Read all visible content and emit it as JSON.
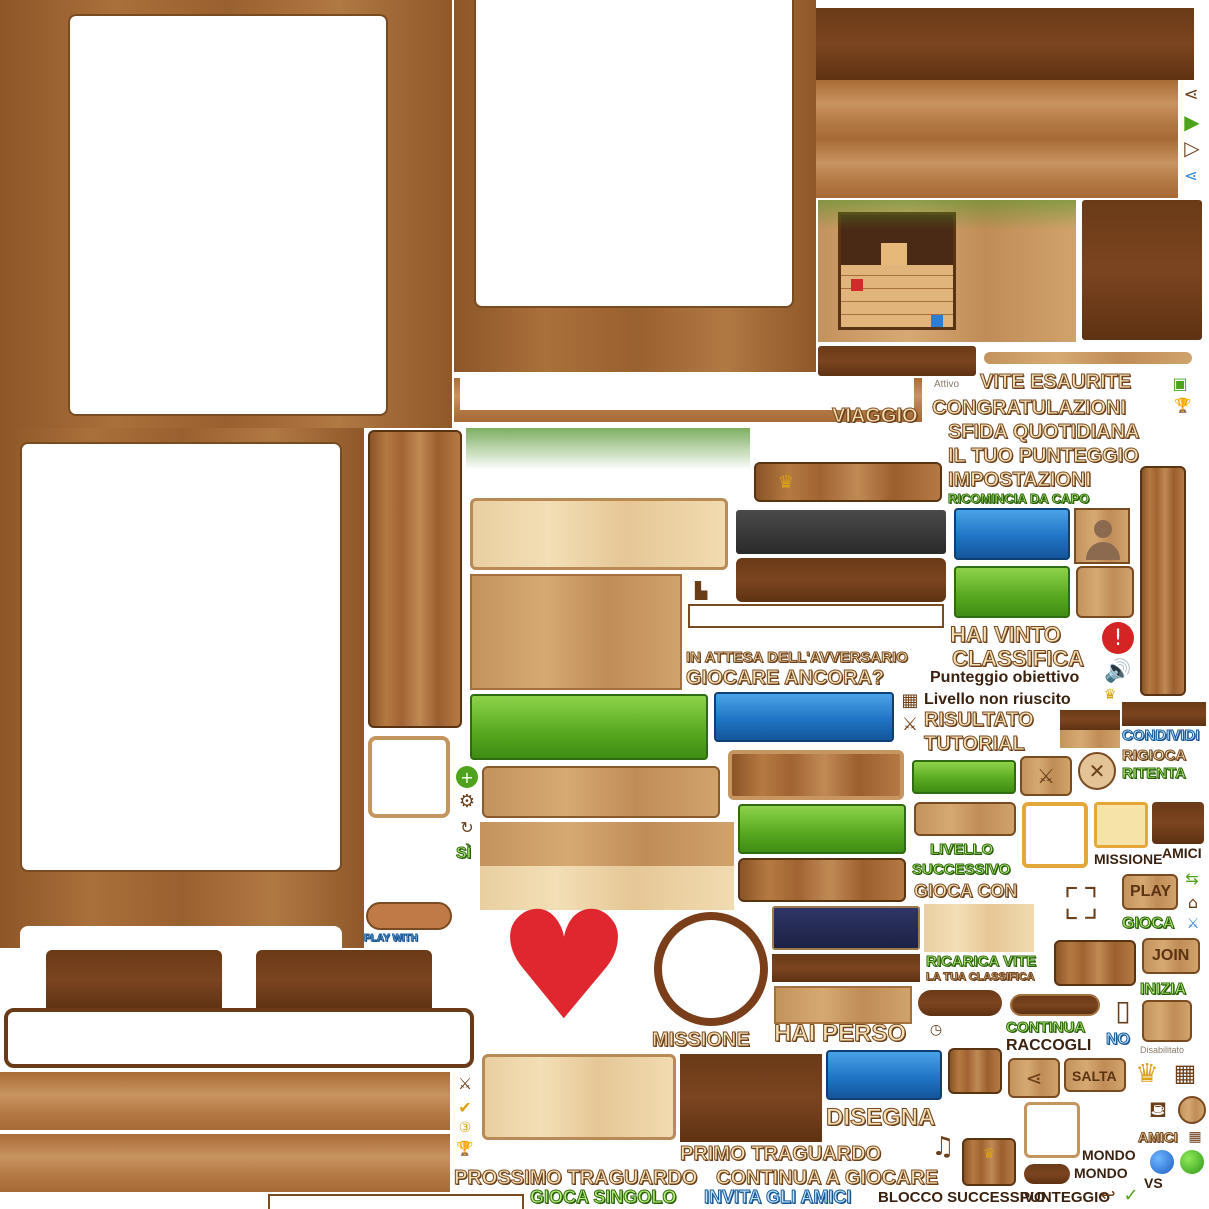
{
  "atlas": {
    "labels": {
      "attivo": "Attivo",
      "vite_esaurite": "VITE ESAURITE",
      "viaggio": "VIAGGIO",
      "congratulazioni": "CONGRATULAZIONI",
      "sfida_quotidiana": "SFIDA QUOTIDIANA",
      "il_tuo_punteggio": "IL TUO PUNTEGGIO",
      "impostazioni": "IMPOSTAZIONI",
      "ricomincia": "RICOMINCIA DA CAPO",
      "hai_vinto": "HAI VINTO",
      "classifica": "CLASSIFICA",
      "in_attesa": "IN ATTESA DELL'AVVERSARIO",
      "punteggio_obiettivo": "Punteggio obiettivo",
      "giocare_ancora": "GIOCARE ANCORA?",
      "livello_non_riuscito": "Livello non riuscito",
      "risultato": "RISULTATO",
      "tutorial": "TUTORIAL",
      "condividi": "CONDIVIDI",
      "rigioca": "RIGIOCA",
      "ritenta": "RITENTA",
      "si": "SÌ",
      "missione_small": "MISSIONE",
      "amici_small": "AMICI",
      "livello_successivo_1": "LIVELLO",
      "livello_successivo_2": "SUCCESSIVO",
      "gioca_con": "GIOCA CON",
      "play_with": "PLAY WITH",
      "play": "PLAY",
      "gioca": "GIOCA",
      "join": "JOIN",
      "ricarica_vite": "RICARICA VITE",
      "la_tua_classifica": "LA TUA CLASSIFICA",
      "inizia": "INIZIA",
      "missione": "MISSIONE",
      "hai_perso": "HAI PERSO",
      "continua": "CONTINUA",
      "raccogli": "RACCOGLI",
      "no": "NO",
      "disabilitato": "Disabilitato",
      "salta": "SALTA",
      "disegna": "DISEGNA",
      "amici": "AMICI",
      "primo_traguardo": "PRIMO TRAGUARDO",
      "mondo_1": "MONDO",
      "mondo_2": "MONDO",
      "prossimo_traguardo": "PROSSIMO TRAGUARDO",
      "continua_a_giocare": "CONTINUA A GIOCARE",
      "vs": "VS",
      "gioca_singolo": "GIOCA SINGOLO",
      "invita_gli_amici": "INVITA GLI AMICI",
      "blocco_successivo": "BLOCCO SUCCESSIVO",
      "punteggio": "PUNTEGGIO"
    },
    "icons": {
      "share": "share-icon",
      "play": "play-circle-icon",
      "trophy": "trophy-icon",
      "alert": "alert-icon",
      "speaker": "speaker-icon",
      "crown": "crown-icon",
      "plus": "plus-icon",
      "gear": "gear-icon",
      "swords": "swords-icon",
      "close": "close-icon",
      "location": "location-pin-icon",
      "home": "home-icon",
      "phone": "phone-icon",
      "calendar": "calendar-icon",
      "music": "music-note-icon",
      "back": "back-arrow-icon",
      "check": "check-icon",
      "clock": "clock-icon",
      "heart": "heart-icon"
    },
    "colors": {
      "wood_dark": "#6a3a17",
      "wood_mid": "#b57a42",
      "wood_light": "#f1dbb0",
      "green": "#5aab22",
      "blue": "#1f75c5",
      "heart_red": "#e0262e"
    }
  }
}
